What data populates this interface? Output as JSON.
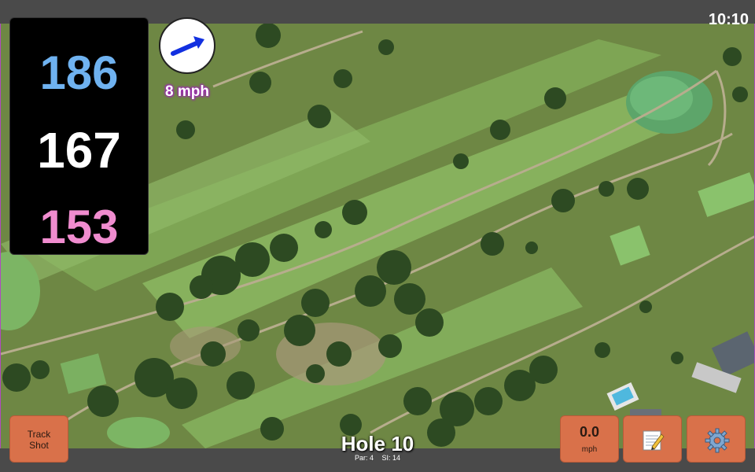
{
  "status_bar": {
    "time": "10:10"
  },
  "distances": {
    "back": "186",
    "middle": "167",
    "front": "153"
  },
  "wind": {
    "speed": "8 mph",
    "direction_icon": "arrow-icon"
  },
  "track_button": {
    "line1": "Track",
    "line2": "Shot"
  },
  "speed_button": {
    "value": "0.0",
    "unit": "mph"
  },
  "notes_button": {
    "icon": "notepad-icon"
  },
  "settings_button": {
    "icon": "gear-icon"
  },
  "hole": {
    "title": "Hole 10",
    "par": "Par: 4",
    "si": "SI: 14"
  },
  "colors": {
    "back_distance": "#6fb2f0",
    "middle_distance": "#ffffff",
    "front_distance": "#f08ccf",
    "button_accent": "#d9714a"
  }
}
